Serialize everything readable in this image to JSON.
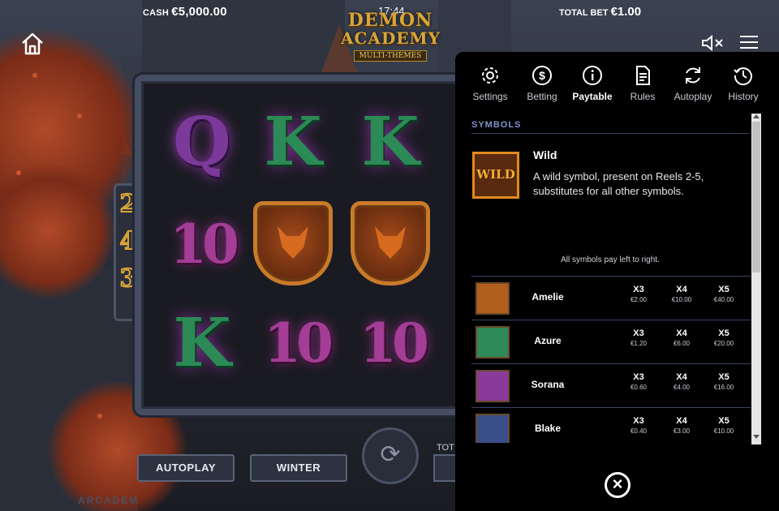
{
  "header": {
    "cash_label": "CASH",
    "cash_value": "€5,000.00",
    "clock": "17:44",
    "bet_label": "TOTAL BET",
    "bet_value": "€1.00"
  },
  "logo": {
    "line1": "DEMON",
    "line2": "ACADEMY",
    "subtitle": "MULTI-THEMES"
  },
  "icons": {
    "home": "home-icon",
    "mute": "speaker-muted-icon",
    "menu": "hamburger-menu-icon"
  },
  "reels": {
    "ways_digits": [
      "2",
      "4",
      "3"
    ],
    "col1": [
      "Q",
      "10",
      "K"
    ],
    "col2": [
      "K",
      "fox-shield",
      "10"
    ],
    "col3": [
      "K",
      "fox-shield",
      "10"
    ]
  },
  "controls": {
    "autoplay_label": "AUTOPLAY",
    "theme_label": "WINTER",
    "total_fragment": "TOT",
    "brand": "ARCADEM"
  },
  "panel": {
    "tabs": [
      {
        "label": "Settings",
        "icon": "gear-icon"
      },
      {
        "label": "Betting",
        "icon": "dollar-icon"
      },
      {
        "label": "Paytable",
        "icon": "info-icon"
      },
      {
        "label": "Rules",
        "icon": "document-icon"
      },
      {
        "label": "Autoplay",
        "icon": "refresh-icon"
      },
      {
        "label": "History",
        "icon": "history-icon"
      }
    ],
    "active_tab": "Paytable",
    "section_title": "SYMBOLS",
    "wild": {
      "icon_text": "WILD",
      "name": "Wild",
      "description": "A wild symbol, present on Reels 2-5, substitutes for all other symbols."
    },
    "pay_note": "All symbols pay left to right.",
    "symbols": [
      {
        "name": "Amelie",
        "x3": "€2.00",
        "x4": "€10.00",
        "x5": "€40.00",
        "color": "#b0601c"
      },
      {
        "name": "Azure",
        "x3": "€1.20",
        "x4": "€6.00",
        "x5": "€20.00",
        "color": "#2e8a58"
      },
      {
        "name": "Sorana",
        "x3": "€0.60",
        "x4": "€4.00",
        "x5": "€16.00",
        "color": "#8a3a9a"
      },
      {
        "name": "Blake",
        "x3": "€0.40",
        "x4": "€3.00",
        "x5": "€10.00",
        "color": "#3a4e8a"
      }
    ],
    "multipliers": [
      "X3",
      "X4",
      "X5"
    ]
  },
  "colors": {
    "accent_gold": "#d9a53a",
    "section_blue": "#7e93c8",
    "panel_bg": "#000000"
  }
}
